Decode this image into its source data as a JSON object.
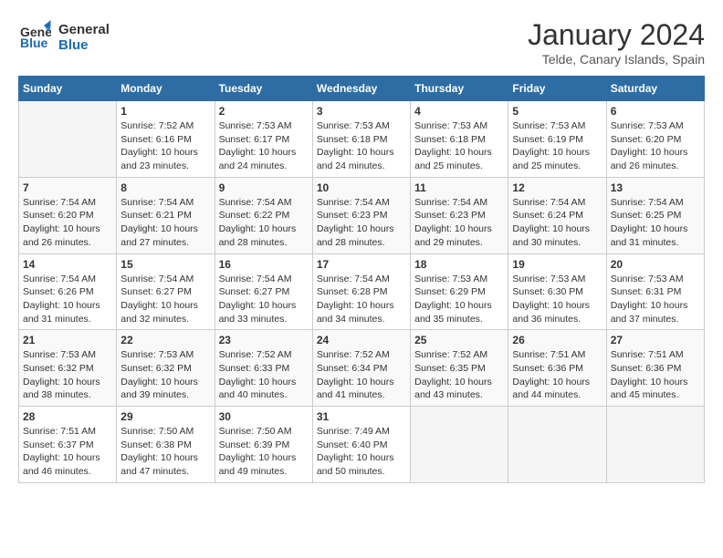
{
  "header": {
    "logo_line1": "General",
    "logo_line2": "Blue",
    "month_year": "January 2024",
    "location": "Telde, Canary Islands, Spain"
  },
  "days_of_week": [
    "Sunday",
    "Monday",
    "Tuesday",
    "Wednesday",
    "Thursday",
    "Friday",
    "Saturday"
  ],
  "weeks": [
    [
      {
        "day": "",
        "info": ""
      },
      {
        "day": "1",
        "info": "Sunrise: 7:52 AM\nSunset: 6:16 PM\nDaylight: 10 hours\nand 23 minutes."
      },
      {
        "day": "2",
        "info": "Sunrise: 7:53 AM\nSunset: 6:17 PM\nDaylight: 10 hours\nand 24 minutes."
      },
      {
        "day": "3",
        "info": "Sunrise: 7:53 AM\nSunset: 6:18 PM\nDaylight: 10 hours\nand 24 minutes."
      },
      {
        "day": "4",
        "info": "Sunrise: 7:53 AM\nSunset: 6:18 PM\nDaylight: 10 hours\nand 25 minutes."
      },
      {
        "day": "5",
        "info": "Sunrise: 7:53 AM\nSunset: 6:19 PM\nDaylight: 10 hours\nand 25 minutes."
      },
      {
        "day": "6",
        "info": "Sunrise: 7:53 AM\nSunset: 6:20 PM\nDaylight: 10 hours\nand 26 minutes."
      }
    ],
    [
      {
        "day": "7",
        "info": "Sunrise: 7:54 AM\nSunset: 6:20 PM\nDaylight: 10 hours\nand 26 minutes."
      },
      {
        "day": "8",
        "info": "Sunrise: 7:54 AM\nSunset: 6:21 PM\nDaylight: 10 hours\nand 27 minutes."
      },
      {
        "day": "9",
        "info": "Sunrise: 7:54 AM\nSunset: 6:22 PM\nDaylight: 10 hours\nand 28 minutes."
      },
      {
        "day": "10",
        "info": "Sunrise: 7:54 AM\nSunset: 6:23 PM\nDaylight: 10 hours\nand 28 minutes."
      },
      {
        "day": "11",
        "info": "Sunrise: 7:54 AM\nSunset: 6:23 PM\nDaylight: 10 hours\nand 29 minutes."
      },
      {
        "day": "12",
        "info": "Sunrise: 7:54 AM\nSunset: 6:24 PM\nDaylight: 10 hours\nand 30 minutes."
      },
      {
        "day": "13",
        "info": "Sunrise: 7:54 AM\nSunset: 6:25 PM\nDaylight: 10 hours\nand 31 minutes."
      }
    ],
    [
      {
        "day": "14",
        "info": "Sunrise: 7:54 AM\nSunset: 6:26 PM\nDaylight: 10 hours\nand 31 minutes."
      },
      {
        "day": "15",
        "info": "Sunrise: 7:54 AM\nSunset: 6:27 PM\nDaylight: 10 hours\nand 32 minutes."
      },
      {
        "day": "16",
        "info": "Sunrise: 7:54 AM\nSunset: 6:27 PM\nDaylight: 10 hours\nand 33 minutes."
      },
      {
        "day": "17",
        "info": "Sunrise: 7:54 AM\nSunset: 6:28 PM\nDaylight: 10 hours\nand 34 minutes."
      },
      {
        "day": "18",
        "info": "Sunrise: 7:53 AM\nSunset: 6:29 PM\nDaylight: 10 hours\nand 35 minutes."
      },
      {
        "day": "19",
        "info": "Sunrise: 7:53 AM\nSunset: 6:30 PM\nDaylight: 10 hours\nand 36 minutes."
      },
      {
        "day": "20",
        "info": "Sunrise: 7:53 AM\nSunset: 6:31 PM\nDaylight: 10 hours\nand 37 minutes."
      }
    ],
    [
      {
        "day": "21",
        "info": "Sunrise: 7:53 AM\nSunset: 6:32 PM\nDaylight: 10 hours\nand 38 minutes."
      },
      {
        "day": "22",
        "info": "Sunrise: 7:53 AM\nSunset: 6:32 PM\nDaylight: 10 hours\nand 39 minutes."
      },
      {
        "day": "23",
        "info": "Sunrise: 7:52 AM\nSunset: 6:33 PM\nDaylight: 10 hours\nand 40 minutes."
      },
      {
        "day": "24",
        "info": "Sunrise: 7:52 AM\nSunset: 6:34 PM\nDaylight: 10 hours\nand 41 minutes."
      },
      {
        "day": "25",
        "info": "Sunrise: 7:52 AM\nSunset: 6:35 PM\nDaylight: 10 hours\nand 43 minutes."
      },
      {
        "day": "26",
        "info": "Sunrise: 7:51 AM\nSunset: 6:36 PM\nDaylight: 10 hours\nand 44 minutes."
      },
      {
        "day": "27",
        "info": "Sunrise: 7:51 AM\nSunset: 6:36 PM\nDaylight: 10 hours\nand 45 minutes."
      }
    ],
    [
      {
        "day": "28",
        "info": "Sunrise: 7:51 AM\nSunset: 6:37 PM\nDaylight: 10 hours\nand 46 minutes."
      },
      {
        "day": "29",
        "info": "Sunrise: 7:50 AM\nSunset: 6:38 PM\nDaylight: 10 hours\nand 47 minutes."
      },
      {
        "day": "30",
        "info": "Sunrise: 7:50 AM\nSunset: 6:39 PM\nDaylight: 10 hours\nand 49 minutes."
      },
      {
        "day": "31",
        "info": "Sunrise: 7:49 AM\nSunset: 6:40 PM\nDaylight: 10 hours\nand 50 minutes."
      },
      {
        "day": "",
        "info": ""
      },
      {
        "day": "",
        "info": ""
      },
      {
        "day": "",
        "info": ""
      }
    ]
  ]
}
